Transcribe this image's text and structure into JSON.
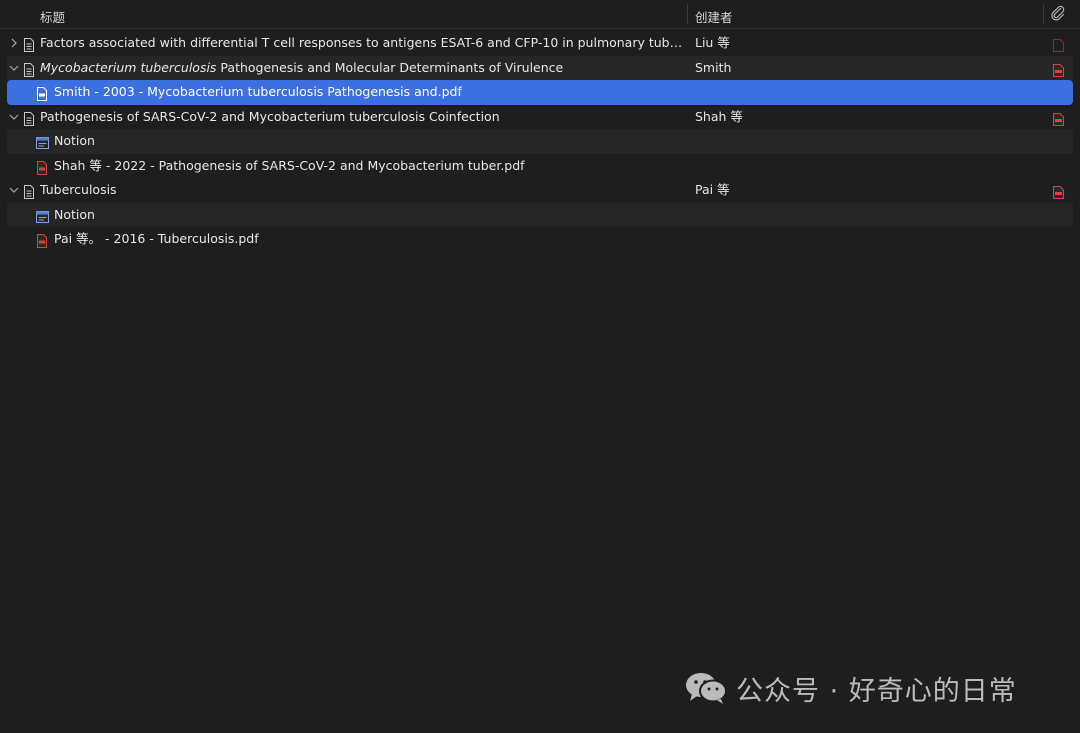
{
  "header": {
    "title_label": "标题",
    "creator_label": "创建者",
    "attachment_icon": "paperclip-icon"
  },
  "rows": [
    {
      "title": "Factors associated with differential T cell responses to antigens ESAT-6 and CFP-10 in pulmonary tuberculosis p...",
      "creator": "Liu 等",
      "expanded": false
    },
    {
      "title_italic": "Mycobacterium tuberculosis",
      "title_rest": " Pathogenesis and Molecular Determinants of Virulence",
      "creator": "Smith",
      "expanded": true,
      "children": [
        {
          "label": "Smith - 2003 - Mycobacterium tuberculosis Pathogenesis and.pdf",
          "kind": "pdf",
          "selected": true
        }
      ]
    },
    {
      "title": "Pathogenesis of SARS-CoV-2 and Mycobacterium tuberculosis Coinfection",
      "creator": "Shah 等",
      "expanded": true,
      "children": [
        {
          "label": "Notion",
          "kind": "note"
        },
        {
          "label": "Shah 等 - 2022 - Pathogenesis of SARS-CoV-2 and Mycobacterium tuber.pdf",
          "kind": "pdf"
        }
      ]
    },
    {
      "title": "Tuberculosis",
      "creator": "Pai 等",
      "expanded": true,
      "children": [
        {
          "label": "Notion",
          "kind": "note"
        },
        {
          "label": "Pai 等。 - 2016 - Tuberculosis.pdf",
          "kind": "pdf"
        }
      ]
    }
  ],
  "watermark": {
    "text": "公众号 · 好奇心的日常",
    "icon": "wechat-icon"
  },
  "colors": {
    "background": "#1e1e1e",
    "alt_row": "#262626",
    "selected": "#3c6fe0",
    "pdf_red": "#d9443a",
    "note_blue": "#5a7fd6"
  }
}
